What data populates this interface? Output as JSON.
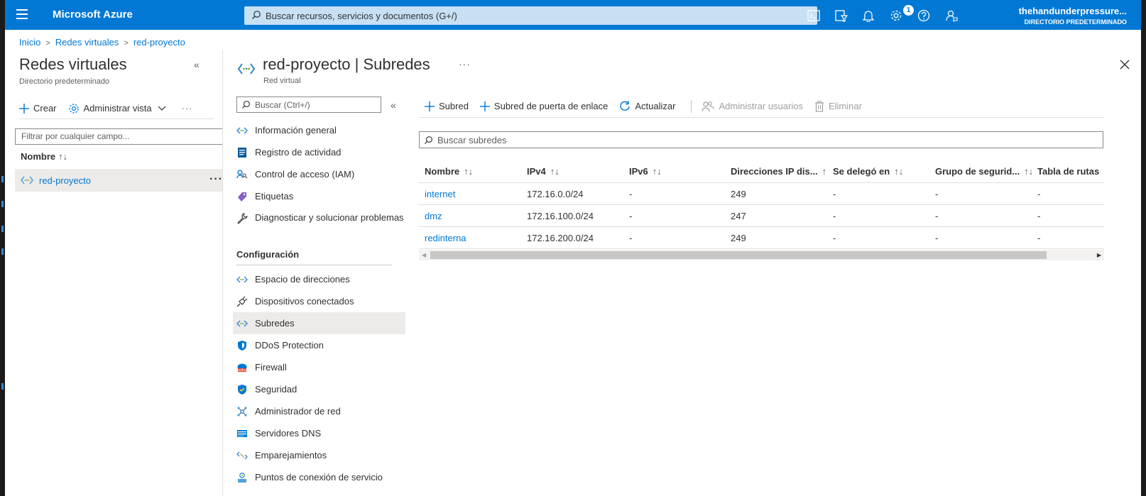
{
  "topbar": {
    "brand": "Microsoft Azure",
    "search_placeholder": "Buscar recursos, servicios y documentos (G+/)",
    "notification_count": "1",
    "user_name": "thehandunderpressure...",
    "user_directory": "DIRECTORIO PREDETERMINADO",
    "icons": [
      "cloud-shell-icon",
      "directory-filter-icon",
      "notifications-icon",
      "settings-icon",
      "help-icon",
      "feedback-icon"
    ],
    "accent_color": "#0078d4"
  },
  "breadcrumb": {
    "items": [
      "Inicio",
      "Redes virtuales",
      "red-proyecto"
    ]
  },
  "left_panel": {
    "title": "Redes virtuales",
    "subtitle": "Directorio predeterminado",
    "create_label": "Crear",
    "manage_view_label": "Administrar vista",
    "filter_placeholder": "Filtrar por cualquier campo...",
    "column_name": "Nombre",
    "sort_glyph": "↑↓",
    "items": [
      {
        "name": "red-proyecto"
      }
    ]
  },
  "blade": {
    "resource_name": "red-proyecto",
    "section": "Subredes",
    "separator": "|",
    "resource_type": "Red virtual",
    "menu_search_placeholder": "Buscar (Ctrl+/)",
    "menu": {
      "items_top": [
        {
          "label": "Información general",
          "icon": "vnet-icon"
        },
        {
          "label": "Registro de actividad",
          "icon": "activity-log-icon"
        },
        {
          "label": "Control de acceso (IAM)",
          "icon": "iam-icon"
        },
        {
          "label": "Etiquetas",
          "icon": "tag-icon"
        },
        {
          "label": "Diagnosticar y solucionar problemas",
          "icon": "wrench-icon"
        }
      ],
      "group_label": "Configuración",
      "items_config": [
        {
          "label": "Espacio de direcciones",
          "icon": "vnet-icon"
        },
        {
          "label": "Dispositivos conectados",
          "icon": "plug-icon"
        },
        {
          "label": "Subredes",
          "icon": "vnet-icon",
          "active": true
        },
        {
          "label": "DDoS Protection",
          "icon": "shield-icon"
        },
        {
          "label": "Firewall",
          "icon": "firewall-icon"
        },
        {
          "label": "Seguridad",
          "icon": "security-shield-icon"
        },
        {
          "label": "Administrador de red",
          "icon": "network-manager-icon"
        },
        {
          "label": "Servidores DNS",
          "icon": "dns-icon"
        },
        {
          "label": "Emparejamientos",
          "icon": "peering-icon"
        },
        {
          "label": "Puntos de conexión de servicio",
          "icon": "service-endpoint-icon"
        }
      ]
    },
    "toolbar": {
      "add_subnet": "Subred",
      "add_gateway_subnet": "Subred de puerta de enlace",
      "refresh": "Actualizar",
      "manage_users": "Administrar usuarios",
      "delete": "Eliminar"
    },
    "subnet_search_placeholder": "Buscar subredes",
    "table": {
      "columns": [
        "Nombre",
        "IPv4",
        "IPv6",
        "Direcciones IP dis...",
        "Se delegó en",
        "Grupo de segurid...",
        "Tabla de rutas"
      ],
      "rows": [
        [
          "internet",
          "172.16.0.0/24",
          "-",
          "249",
          "-",
          "-",
          "-"
        ],
        [
          "dmz",
          "172.16.100.0/24",
          "-",
          "247",
          "-",
          "-",
          "-"
        ],
        [
          "redinterna",
          "172.16.200.0/24",
          "-",
          "249",
          "-",
          "-",
          "-"
        ]
      ]
    }
  }
}
